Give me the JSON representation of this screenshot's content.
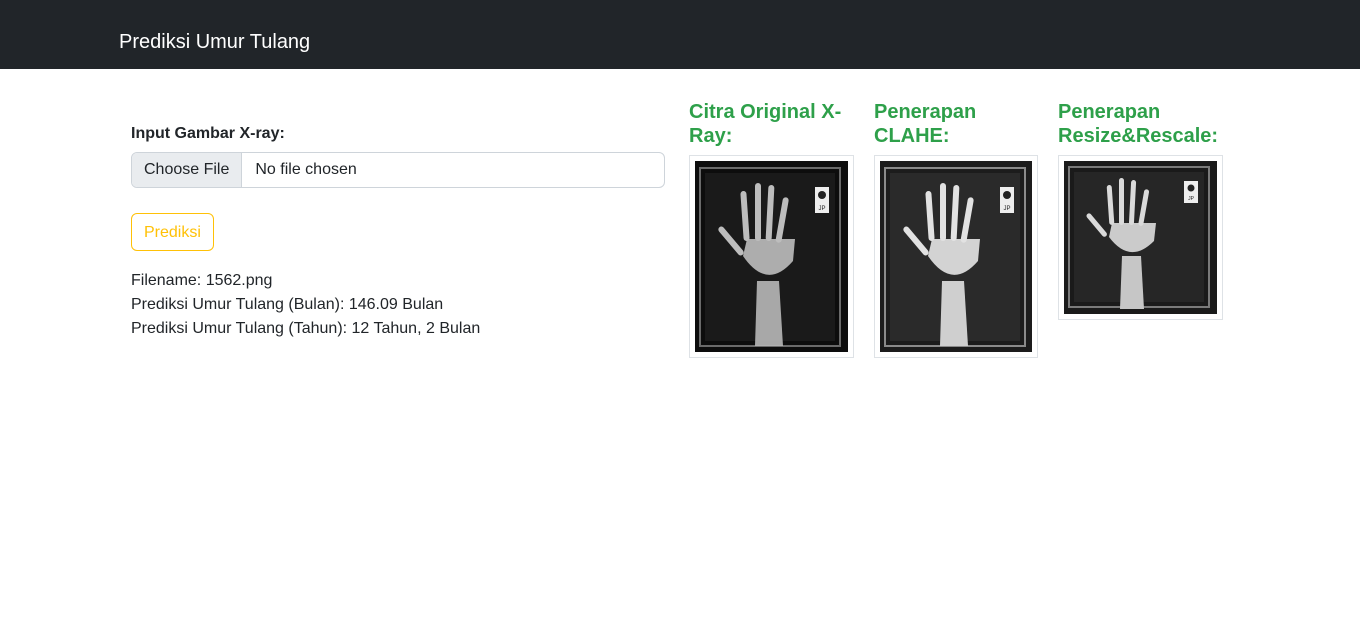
{
  "navbar": {
    "brand": "Prediksi Umur Tulang"
  },
  "form": {
    "label": "Input Gambar X-ray:",
    "file_button": "Choose File",
    "file_status": "No file chosen",
    "submit_label": "Prediksi"
  },
  "results": {
    "filename": "Filename: 1562.png",
    "months": "Prediksi Umur Tulang (Bulan): 146.09 Bulan",
    "years": "Prediksi Umur Tulang (Tahun): 12 Tahun, 2 Bulan"
  },
  "images": [
    {
      "title_line1": "Citra Original X-",
      "title_line2": "Ray:",
      "marker_text": "JP"
    },
    {
      "title_line1": "Penerapan",
      "title_line2": "CLAHE:",
      "marker_text": "JP"
    },
    {
      "title_line1": "Penerapan",
      "title_line2": "Resize&Rescale:",
      "marker_text": "JP"
    }
  ],
  "colors": {
    "navbar": "#212529",
    "accent_green": "#2ea04a",
    "warning": "#ffc107"
  }
}
